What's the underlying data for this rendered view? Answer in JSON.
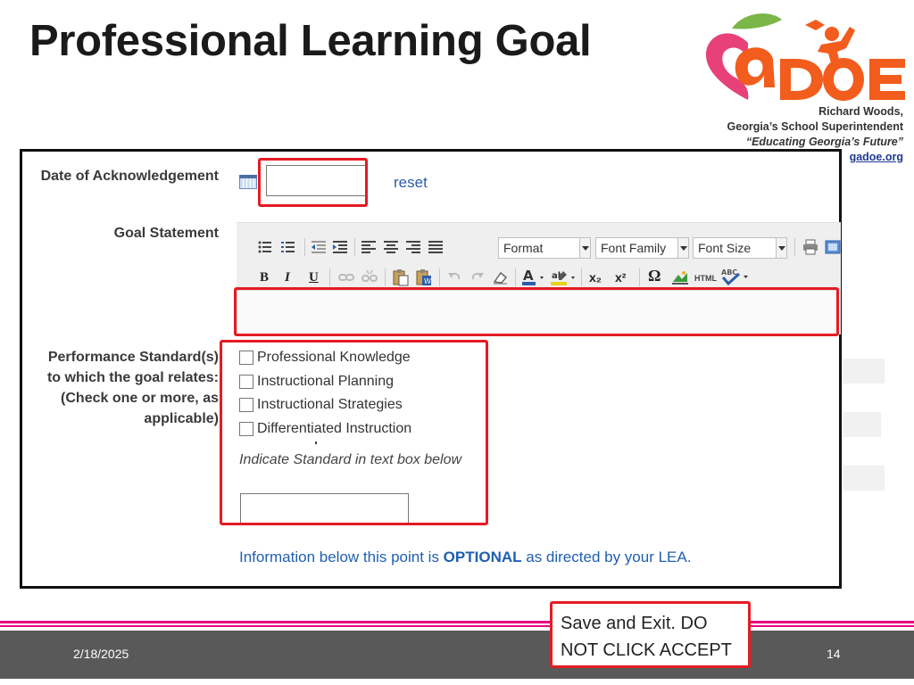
{
  "slide": {
    "title": "Professional Learning Goal",
    "date": "2/18/2025",
    "page_number": "14"
  },
  "branding": {
    "logo_text": "GaDOE",
    "superintendent_name": "Richard Woods,",
    "superintendent_title": "Georgia’s School Superintendent",
    "motto": "“Educating Georgia’s Future”",
    "website": "gadoe.org"
  },
  "form": {
    "date_label": "Date of Acknowledgement",
    "date_value": "",
    "reset_label": "reset",
    "goal_label": "Goal Statement",
    "toolbar": {
      "format_label": "Format",
      "font_family_label": "Font Family",
      "font_size_label": "Font Size",
      "bold": "B",
      "italic": "I",
      "underline": "U",
      "subscript": "x₂",
      "superscript": "x²",
      "omega": "Ω",
      "html": "HTML"
    },
    "standards_label_lines": [
      "Performance Standard(s)",
      "to which the goal relates:",
      "(Check one or more, as",
      "applicable)"
    ],
    "standards": [
      "Professional Knowledge",
      "Instructional Planning",
      "Instructional Strategies",
      "Differentiated Instruction"
    ],
    "indicate_text": "Indicate Standard in text box below",
    "optional_prefix": "Information below this point is ",
    "optional_bold": "OPTIONAL",
    "optional_suffix": " as directed by your LEA."
  },
  "callout": {
    "line1": "Save and Exit. DO",
    "line2": "NOT CLICK ACCEPT"
  },
  "colors": {
    "highlight": "#e51b23",
    "footer_accent": "#e6007e",
    "footer_bar": "#595959",
    "link": "#2c5ea8"
  }
}
